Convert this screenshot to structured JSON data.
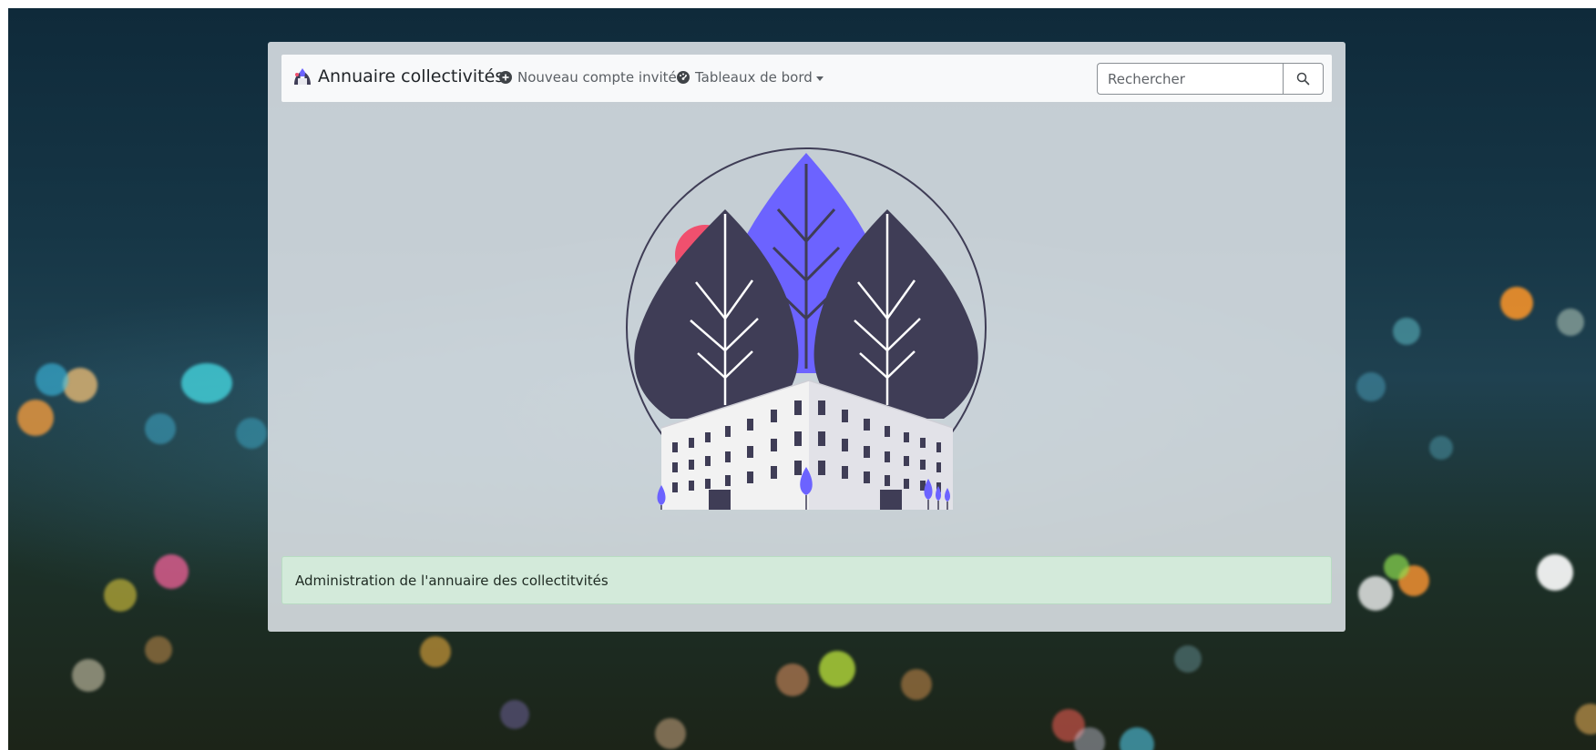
{
  "navbar": {
    "brand_label": "Annuaire collectivités",
    "links": [
      {
        "label": "Nouveau compte invité",
        "icon": "plus-circle-icon"
      },
      {
        "label": "Tableaux de bord",
        "icon": "dashboard-gauge-icon",
        "dropdown": true
      }
    ],
    "search": {
      "placeholder": "Rechercher",
      "value": "",
      "icon": "search-icon"
    }
  },
  "hero": {
    "illustration": "city-buildings-leaves-illustration"
  },
  "alert": {
    "message": "Administration de l'annuaire des collectitvités"
  },
  "colors": {
    "accent_purple": "#6c63ff",
    "dark_leaf": "#3f3d56",
    "pink_sun": "#f0506e",
    "alert_green": "#d4edda"
  }
}
